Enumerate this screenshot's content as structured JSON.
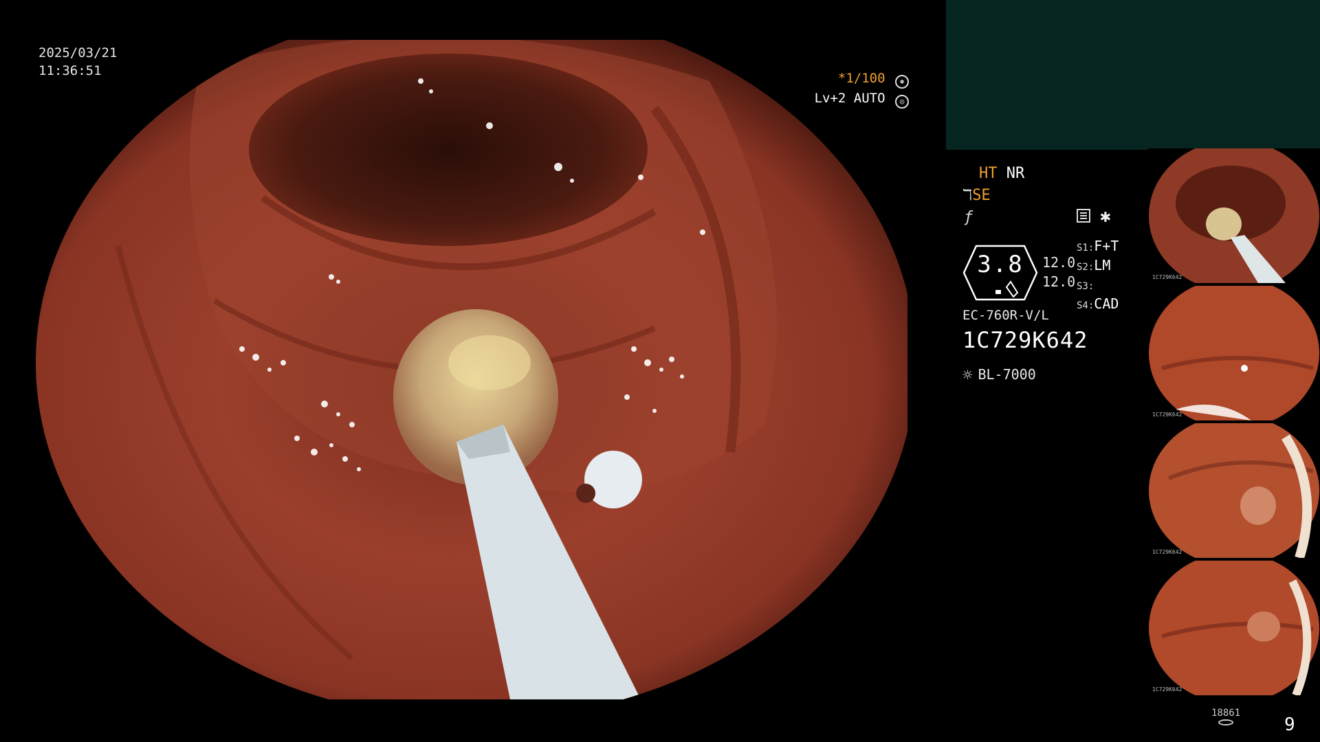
{
  "overlay": {
    "date": "2025/03/21",
    "time": "11:36:51",
    "shutter": "*1/100",
    "level": "Lv+2 AUTO"
  },
  "panel": {
    "mode_ht": "HT",
    "mode_nr": "NR",
    "mode_se": "SE",
    "dial_value": "3.8",
    "dial_num_1": "12.0",
    "dial_num_2": "12.0",
    "settings": [
      {
        "key": "S1:",
        "value": "F+T"
      },
      {
        "key": "S2:",
        "value": "LM"
      },
      {
        "key": "S3:",
        "value": ""
      },
      {
        "key": "S4:",
        "value": "CAD"
      }
    ],
    "scope_model": "EC-760R-V/L",
    "scope_serial": "1C729K642",
    "light_source": "BL-7000"
  },
  "thumbnails": [
    {
      "label": "1C729K642"
    },
    {
      "label": "1C729K642"
    },
    {
      "label": "1C729K642"
    },
    {
      "label": "1C729K642"
    }
  ],
  "footer": {
    "image_count": "18861",
    "page": "9"
  },
  "icons": [
    "shutter-icon",
    "auto-iris-icon",
    "menu-icon",
    "light-source-icon",
    "storage-icon"
  ],
  "colors": {
    "accent": "#f0a030",
    "top_panel": "#072520",
    "mucosa": "#8a3424"
  }
}
